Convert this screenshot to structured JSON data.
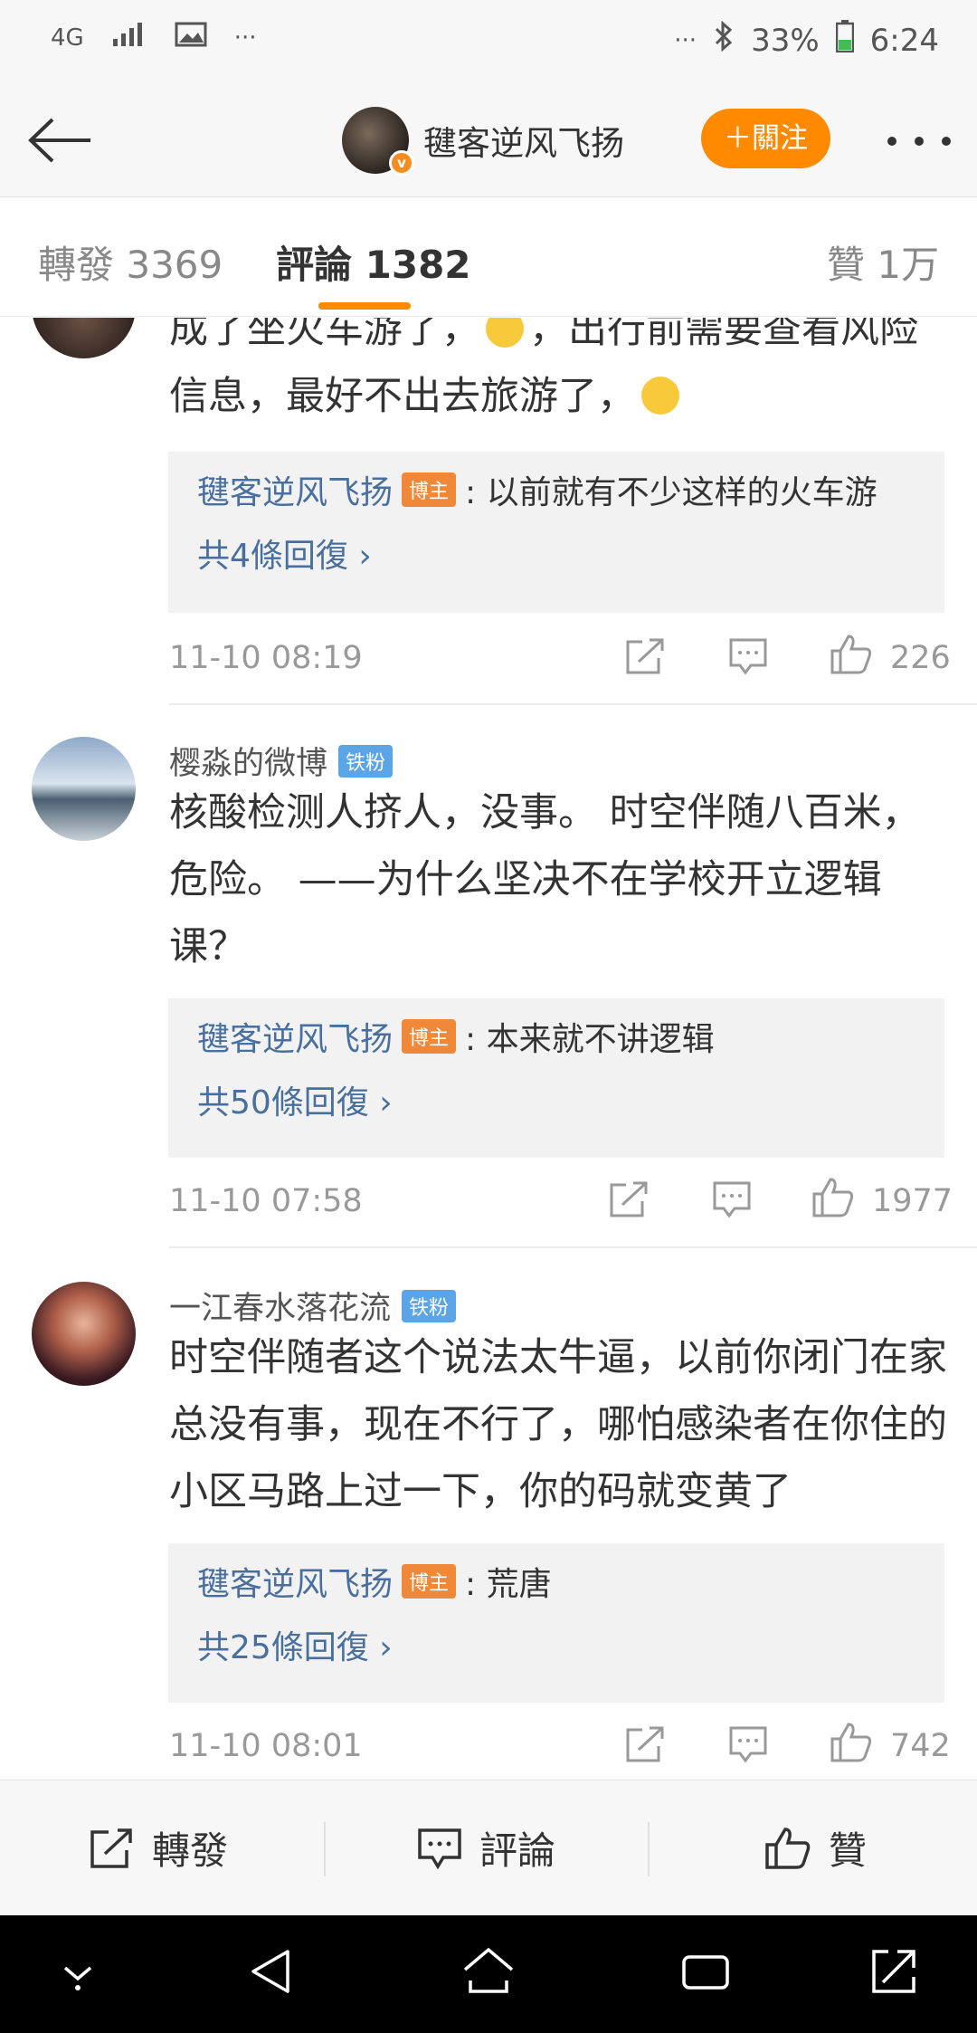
{
  "status_bar": {
    "network": "4G",
    "dots": "···",
    "battery": "33%",
    "time": "6:24"
  },
  "header": {
    "author_name": "毽客逆风飞扬",
    "follow_label": "＋關注"
  },
  "tabs": {
    "reposts": "轉發 3369",
    "comments": "評論 1382",
    "likes": "贊 1万"
  },
  "comments": [
    {
      "username": "",
      "badge": "",
      "text_line1": "成了坐火车游了，",
      "text_line1b": "，出行前需要查看风险",
      "text_line2": "信息，最好不出去旅游了，",
      "reply_author": "毽客逆风飞扬",
      "reply_badge": "博主",
      "reply_text": ": 以前就有不少这样的火车游",
      "reply_count": "共4條回復 ›",
      "time": "11-10 08:19",
      "likes": "226"
    },
    {
      "username": "樱淼的微博",
      "badge": "铁粉",
      "text": "核酸检测人挤人，没事。 时空伴随八百米，危险。 ——为什么坚决不在学校开立逻辑课？",
      "reply_author": "毽客逆风飞扬",
      "reply_badge": "博主",
      "reply_text": ": 本来就不讲逻辑",
      "reply_count": "共50條回復 ›",
      "time": "11-10 07:58",
      "likes": "1977"
    },
    {
      "username": "一江春水落花流",
      "badge": "铁粉",
      "text": "时空伴随者这个说法太牛逼，以前你闭门在家总没有事，现在不行了，哪怕感染者在你住的小区马路上过一下，你的码就变黄了",
      "reply_author": "毽客逆风飞扬",
      "reply_badge": "博主",
      "reply_text": ": 荒唐",
      "reply_count": "共25條回復 ›",
      "time": "11-10 08:01",
      "likes": "742"
    }
  ],
  "action_bar": {
    "repost": "轉發",
    "comment": "評論",
    "like": "贊"
  },
  "colors": {
    "accent": "#ff8a00",
    "link": "#496f9e",
    "fan_badge": "#5ba4e6",
    "blogger_badge": "#f0883a"
  },
  "icons": [
    "back-arrow-icon",
    "more-icon",
    "repost-icon",
    "comment-icon",
    "like-icon",
    "bluetooth-icon",
    "signal-icon",
    "image-icon",
    "battery-icon"
  ]
}
